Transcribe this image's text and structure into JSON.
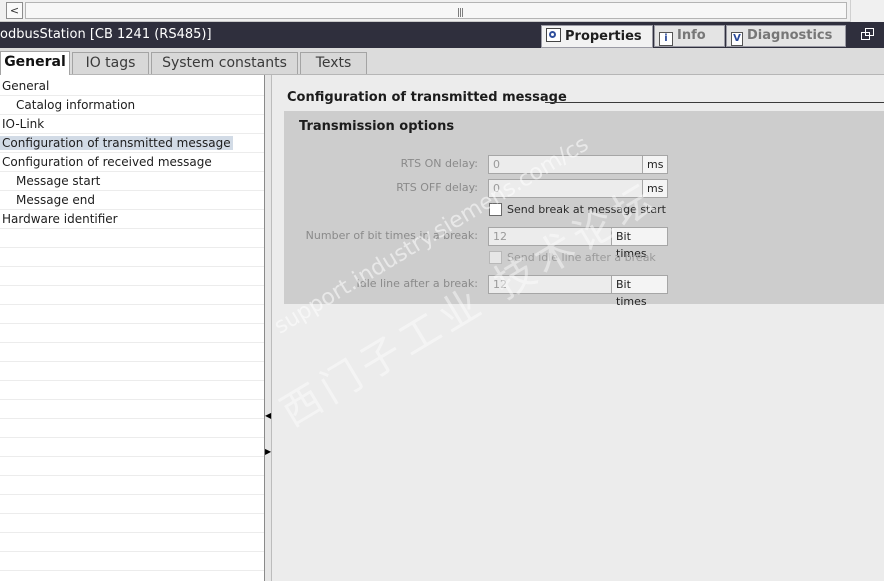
{
  "scrollbar": {
    "left_arrow": "<",
    "grip": "|||"
  },
  "titlebar": {
    "device_title": "odbusStation [CB 1241 (RS485)]",
    "tabs": [
      {
        "label": "Properties",
        "icon": "properties-icon"
      },
      {
        "label": "Info",
        "icon": "info-icon"
      },
      {
        "label": "Diagnostics",
        "icon": "diagnostics-icon"
      }
    ]
  },
  "subtabs": [
    "General",
    "IO tags",
    "System constants",
    "Texts"
  ],
  "nav": {
    "items": [
      {
        "label": "General",
        "level": 0
      },
      {
        "label": "Catalog information",
        "level": 1
      },
      {
        "label": "IO-Link",
        "level": 0
      },
      {
        "label": "Configuration of transmitted message",
        "level": 0,
        "selected": true
      },
      {
        "label": "Configuration of received message",
        "level": 0
      },
      {
        "label": "Message start",
        "level": 1
      },
      {
        "label": "Message end",
        "level": 1
      },
      {
        "label": "Hardware identifier",
        "level": 0
      }
    ]
  },
  "main": {
    "section_title": "Configuration of transmitted message",
    "group_title": "Transmission options",
    "rts_on": {
      "label": "RTS ON delay:",
      "value": "0",
      "unit": "ms"
    },
    "rts_off": {
      "label": "RTS OFF delay:",
      "value": "0",
      "unit": "ms"
    },
    "send_break": {
      "label": "Send break at message start",
      "checked": false
    },
    "bit_times": {
      "label": "Number of bit times in a break:",
      "value": "12",
      "unit": "Bit times"
    },
    "send_idle": {
      "label": "Send idle line after a break",
      "checked": false,
      "enabled": false
    },
    "idle_line": {
      "label": "Idle line after a break:",
      "value": "12",
      "unit": "Bit times"
    }
  },
  "watermark": {
    "latin": "support.industry.siemens.com/cs",
    "chinese": "西门子工业  技术论坛"
  }
}
